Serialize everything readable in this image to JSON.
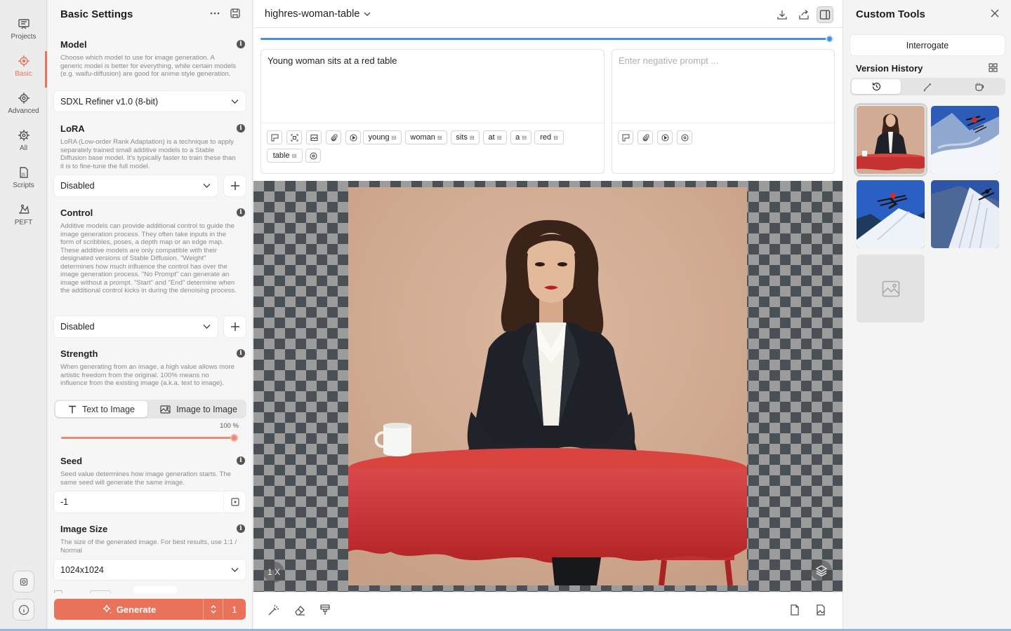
{
  "nav": {
    "items": [
      {
        "label": "Projects",
        "icon": "projects-icon",
        "active": false
      },
      {
        "label": "Basic",
        "icon": "basic-icon",
        "active": true
      },
      {
        "label": "Advanced",
        "icon": "advanced-icon",
        "active": false
      },
      {
        "label": "All",
        "icon": "all-icon",
        "active": false
      },
      {
        "label": "Scripts",
        "icon": "scripts-icon",
        "active": false
      },
      {
        "label": "PEFT",
        "icon": "peft-icon",
        "active": false
      }
    ]
  },
  "settings": {
    "title": "Basic Settings",
    "model": {
      "title": "Model",
      "desc": "Choose which model to use for image generation. A generic model is better for everything, while certain models (e.g. waifu-diffusion) are good for anime style generation.",
      "value": "SDXL Refiner v1.0 (8-bit)"
    },
    "lora": {
      "title": "LoRA",
      "desc": "LoRA (Low-order Rank Adaptation) is a technique to apply separately trained small additive models to a Stable Diffusion base model. It's typically faster to train these than it is to fine-tune the full model.",
      "value": "Disabled"
    },
    "control": {
      "title": "Control",
      "desc": "Additive models can provide additional control to guide the image generation process. They often take inputs in the form of scribbles, poses, a depth map or an edge map. These additive models are only compatible with their designated versions of Stable Diffusion. \"Weight\" determines how much influence the control has over the image generation process. \"No Prompt\" can generate an image without a prompt. \"Start\" and \"End\" determine when the additional control kicks in during the denoising process.",
      "value": "Disabled"
    },
    "strength": {
      "title": "Strength",
      "desc": "When generating from an image, a high value allows more artistic freedom from the original. 100% means no influence from the existing image (a.k.a. text to image).",
      "mode_text": "Text to Image",
      "mode_image": "Image to Image",
      "value_label": "100 %",
      "value": 1.0
    },
    "seed": {
      "title": "Seed",
      "desc": "Seed value determines how image generation starts. The same seed will generate the same image.",
      "value": "-1"
    },
    "image_size": {
      "title": "Image Size",
      "desc": "The size of the generated image. For best results, use 1:1 / Normal",
      "value": "1024x1024"
    },
    "generate": {
      "label": "Generate",
      "count": "1"
    }
  },
  "main": {
    "project_name": "highres-woman-table",
    "progress": 1.0,
    "prompt": "Young woman sits at a red table",
    "negative_placeholder": "Enter negative prompt ...",
    "prompt_tokens": [
      "young",
      "woman",
      "sits",
      "at",
      "a",
      "red",
      "table"
    ],
    "zoom": "1 X"
  },
  "right": {
    "title": "Custom Tools",
    "interrogate_label": "Interrogate",
    "version_history_title": "Version History"
  },
  "colors": {
    "accent": "#e8735a",
    "progress": "#4a90d9"
  }
}
